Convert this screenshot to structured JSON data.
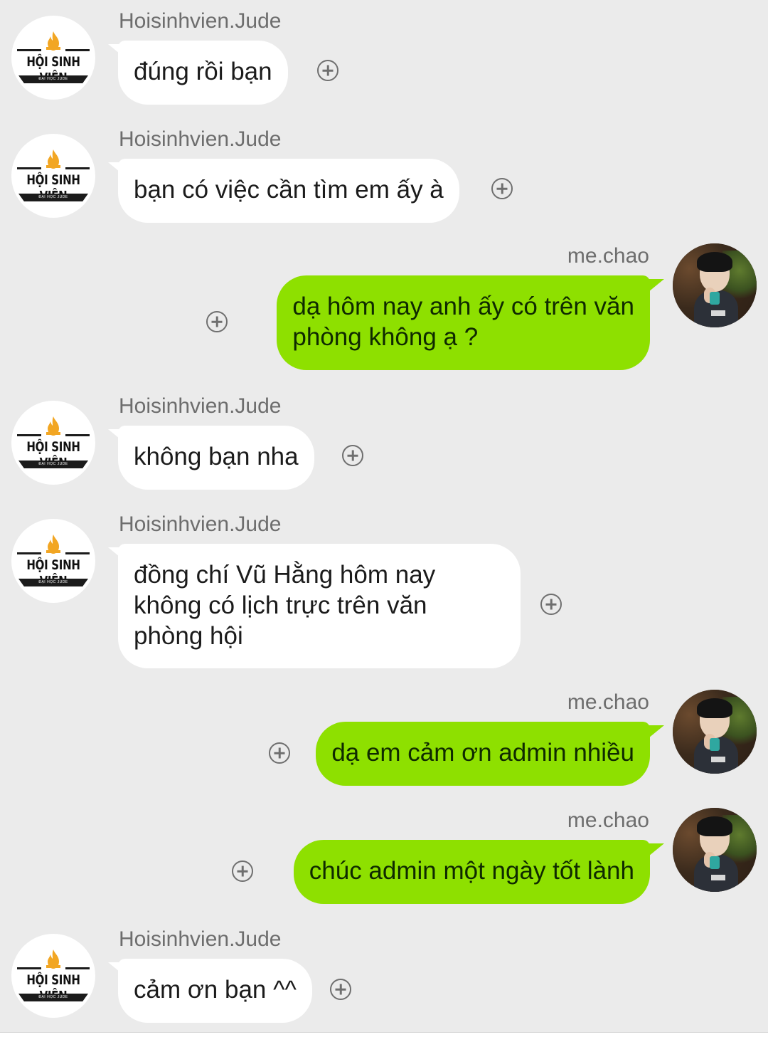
{
  "colors": {
    "background": "#ebebeb",
    "incoming_bubble": "#ffffff",
    "outgoing_bubble": "#8ee000",
    "logo_flame": "#f2a623"
  },
  "logo": {
    "title": "HỘI SINH VIÊN",
    "subtitle": "ĐẠI HỌC JUDE"
  },
  "messages": [
    {
      "sender": "Hoisinhvien.Jude",
      "text": "đúng rồi bạn"
    },
    {
      "sender": "Hoisinhvien.Jude",
      "text": "bạn có việc cần tìm em ấy à"
    },
    {
      "sender": "me.chao",
      "text": "dạ hôm nay anh ấy có trên văn\nphòng không ạ ?"
    },
    {
      "sender": "Hoisinhvien.Jude",
      "text": "không bạn nha"
    },
    {
      "sender": "Hoisinhvien.Jude",
      "text": "đồng chí Vũ Hằng hôm nay\nkhông có lịch trực trên văn\nphòng hội"
    },
    {
      "sender": "me.chao",
      "text": "dạ em cảm ơn admin nhiều"
    },
    {
      "sender": "me.chao",
      "text": "chúc admin một ngày tốt lành"
    },
    {
      "sender": "Hoisinhvien.Jude",
      "text": "cảm ơn bạn ^^"
    }
  ]
}
